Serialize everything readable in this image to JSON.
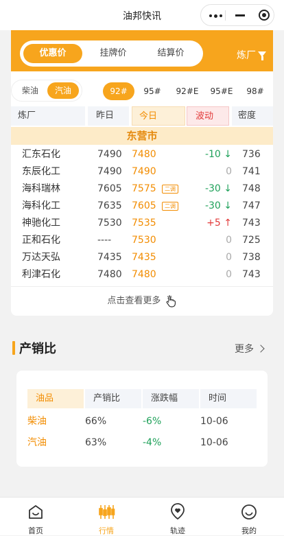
{
  "app": {
    "title": "油邦快讯"
  },
  "price_tabs": [
    {
      "label": "优惠价",
      "active": true
    },
    {
      "label": "挂牌价",
      "active": false
    },
    {
      "label": "结算价",
      "active": false
    }
  ],
  "refinery_filter": {
    "label": "炼厂"
  },
  "fuel_types": [
    {
      "label": "柴油",
      "active": false
    },
    {
      "label": "汽油",
      "active": true
    }
  ],
  "grades": [
    {
      "label": "92#",
      "active": true
    },
    {
      "label": "95#",
      "active": false
    },
    {
      "label": "92#E",
      "active": false
    },
    {
      "label": "95#E",
      "active": false
    },
    {
      "label": "98#",
      "active": false
    }
  ],
  "table": {
    "headers": {
      "refinery": "炼厂",
      "yesterday": "昨日",
      "today": "今日",
      "change": "波动",
      "density": "密度"
    },
    "city": "东营市",
    "rows": [
      {
        "name": "汇东石化",
        "yesterday": "7490",
        "today": "7480",
        "tag": "",
        "change": "-10",
        "trend": "down",
        "density": "736"
      },
      {
        "name": "东辰化工",
        "yesterday": "7490",
        "today": "7490",
        "tag": "",
        "change": "0",
        "trend": "flat",
        "density": "741"
      },
      {
        "name": "海科瑞林",
        "yesterday": "7605",
        "today": "7575",
        "tag": "二调",
        "change": "-30",
        "trend": "down",
        "density": "748"
      },
      {
        "name": "海科化工",
        "yesterday": "7635",
        "today": "7605",
        "tag": "二调",
        "change": "-30",
        "trend": "down",
        "density": "747"
      },
      {
        "name": "神驰化工",
        "yesterday": "7530",
        "today": "7535",
        "tag": "",
        "change": "+5",
        "trend": "up",
        "density": "743"
      },
      {
        "name": "正和石化",
        "yesterday": "----",
        "today": "7530",
        "tag": "",
        "change": "0",
        "trend": "flat",
        "density": "725"
      },
      {
        "name": "万达天弘",
        "yesterday": "7435",
        "today": "7435",
        "tag": "",
        "change": "0",
        "trend": "flat",
        "density": "738"
      },
      {
        "name": "利津石化",
        "yesterday": "7480",
        "today": "7480",
        "tag": "",
        "change": "0",
        "trend": "flat",
        "density": "743"
      }
    ],
    "more_label": "点击查看更多"
  },
  "ratio_section": {
    "title": "产销比",
    "more_label": "更多",
    "headers": [
      "油品",
      "产销比",
      "涨跌幅",
      "时间"
    ],
    "rows": [
      {
        "product": "柴油",
        "ratio": "66%",
        "change": "-6%",
        "date": "10-06"
      },
      {
        "product": "汽油",
        "ratio": "63%",
        "change": "-4%",
        "date": "10-06"
      }
    ]
  },
  "nav": [
    {
      "label": "首页",
      "icon": "home-icon",
      "active": false
    },
    {
      "label": "行情",
      "icon": "candlestick-icon",
      "active": true
    },
    {
      "label": "轨迹",
      "icon": "location-icon",
      "active": false
    },
    {
      "label": "我的",
      "icon": "user-icon",
      "active": false
    }
  ],
  "colors": {
    "accent": "#f7a51d",
    "up": "#e23a3a",
    "down": "#1fa15a"
  }
}
